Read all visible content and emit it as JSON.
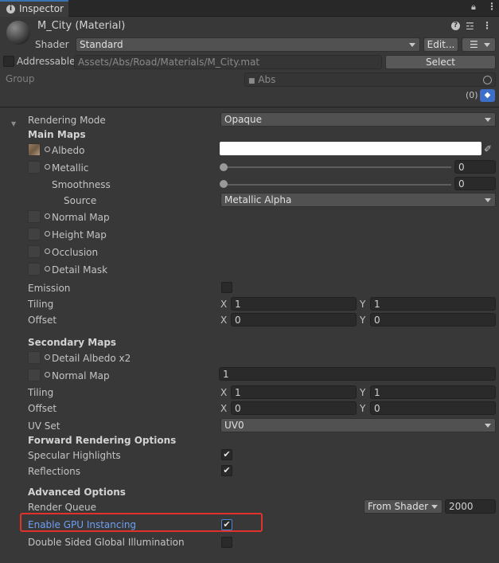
{
  "tab": {
    "title": "Inspector"
  },
  "header": {
    "material_name": "M_City (Material)",
    "shader_label": "Shader",
    "shader_value": "Standard",
    "edit_button": "Edit...",
    "addressable_label": "Addressable",
    "address_path": "Assets/Abs/Road/Materials/M_City.mat",
    "select_button": "Select",
    "group_label": "Group",
    "group_value": "Abs",
    "label_count": "(0)"
  },
  "properties": {
    "rendering_mode_label": "Rendering Mode",
    "rendering_mode_value": "Opaque",
    "main_maps_heading": "Main Maps",
    "albedo_label": "Albedo",
    "metallic_label": "Metallic",
    "metallic_value": "0",
    "smoothness_label": "Smoothness",
    "smoothness_value": "0",
    "source_label": "Source",
    "source_value": "Metallic Alpha",
    "normal_map_label": "Normal Map",
    "height_map_label": "Height Map",
    "occlusion_label": "Occlusion",
    "detail_mask_label": "Detail Mask",
    "emission_label": "Emission",
    "tiling_label": "Tiling",
    "offset_label": "Offset",
    "x_label": "X",
    "y_label": "Y",
    "main_tiling_x": "1",
    "main_tiling_y": "1",
    "main_offset_x": "0",
    "main_offset_y": "0",
    "secondary_maps_heading": "Secondary Maps",
    "detail_albedo_label": "Detail Albedo x2",
    "secondary_normal_map_label": "Normal Map",
    "secondary_normal_value": "1",
    "sec_tiling_x": "1",
    "sec_tiling_y": "1",
    "sec_offset_x": "0",
    "sec_offset_y": "0",
    "uv_set_label": "UV Set",
    "uv_set_value": "UV0",
    "forward_heading": "Forward Rendering Options",
    "specular_label": "Specular Highlights",
    "reflections_label": "Reflections",
    "advanced_heading": "Advanced Options",
    "render_queue_label": "Render Queue",
    "render_queue_mode": "From Shader",
    "render_queue_value": "2000",
    "gpu_instancing_label": "Enable GPU Instancing",
    "double_sided_gi_label": "Double Sided Global Illumination"
  },
  "colors": {
    "highlight_box": "#e0312b",
    "gpu_label": "#6d9ff5",
    "label_badge": "#3d6ec8"
  }
}
